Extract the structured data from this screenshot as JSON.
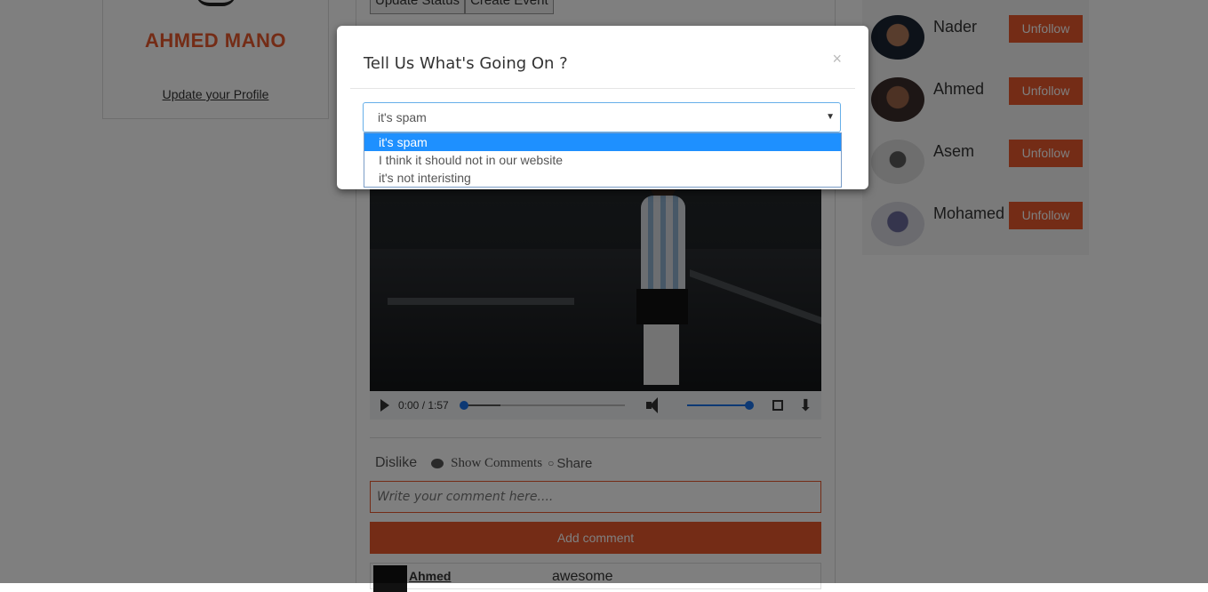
{
  "profile": {
    "name": "AHMED MANO",
    "update_link": "Update your Profile"
  },
  "feed": {
    "tabs": [
      "Update Status",
      "Create Event"
    ],
    "video": {
      "time": "0:00 / 1:57",
      "progress_fraction": 0.0,
      "volume_fraction": 1.0
    },
    "actions": {
      "dislike": "Dislike",
      "show_comments": "Show Comments",
      "share": "Share"
    },
    "comment_input_placeholder": "Write your comment here....",
    "add_comment_label": "Add comment",
    "comments": [
      {
        "author": "Ahmed",
        "text": "awesome"
      }
    ]
  },
  "following": {
    "unfollow_label": "Unfollow",
    "users": [
      {
        "name": "Nader"
      },
      {
        "name": "Ahmed"
      },
      {
        "name": "Asem"
      },
      {
        "name": "Mohamed"
      }
    ]
  },
  "modal": {
    "title": "Tell Us What's Going On ?",
    "close_symbol": "×",
    "select": {
      "selected": "it's spam",
      "options": [
        "it's spam",
        "I think it should not in our website",
        "it's not interisting"
      ]
    }
  },
  "colors": {
    "accent": "#e8582c",
    "overlay": "rgba(0,0,0,0.5)",
    "option_highlight": "#1e90ff"
  }
}
